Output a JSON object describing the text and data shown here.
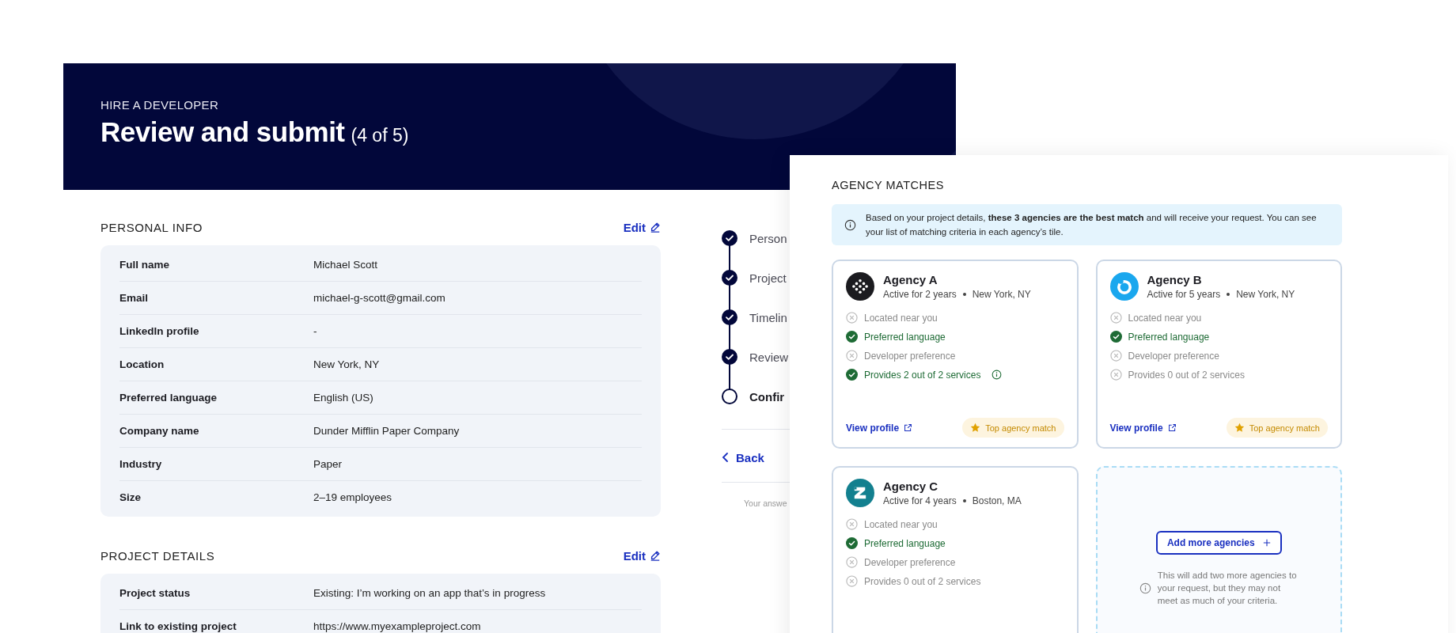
{
  "header": {
    "eyebrow": "HIRE A DEVELOPER",
    "title": "Review and submit",
    "step": "(4 of 5)"
  },
  "sections": [
    {
      "title": "PERSONAL INFO",
      "edit": "Edit",
      "rows": [
        {
          "label": "Full name",
          "value": "Michael Scott"
        },
        {
          "label": "Email",
          "value": "michael-g-scott@gmail.com"
        },
        {
          "label": "LinkedIn profile",
          "value": "-"
        },
        {
          "label": "Location",
          "value": "New York, NY"
        },
        {
          "label": "Preferred language",
          "value": "English (US)"
        },
        {
          "label": "Company name",
          "value": "Dunder Mifflin Paper Company"
        },
        {
          "label": "Industry",
          "value": "Paper"
        },
        {
          "label": "Size",
          "value": "2–19 employees"
        }
      ]
    },
    {
      "title": "PROJECT DETAILS",
      "edit": "Edit",
      "rows": [
        {
          "label": "Project status",
          "value": "Existing: I’m working on an app that’s in progress"
        },
        {
          "label": "Link to existing project",
          "value": "https://www.myexampleproject.com"
        }
      ]
    }
  ],
  "stepper": {
    "steps": [
      {
        "label": "Person",
        "completed": true,
        "current": false
      },
      {
        "label": "Project",
        "completed": true,
        "current": false
      },
      {
        "label": "Timelin",
        "completed": true,
        "current": false
      },
      {
        "label": "Review",
        "completed": true,
        "current": false
      },
      {
        "label": "Confir",
        "completed": false,
        "current": true
      }
    ],
    "back": "Back",
    "footnote": "Your answe"
  },
  "agency_panel": {
    "title": "AGENCY MATCHES",
    "notice": "Based on your project details, **these 3 agencies are the best match** and will receive your request. You can see your list of matching criteria in each agency’s tile.",
    "agencies": [
      {
        "name": "Agency A",
        "active": "Active for 2 years",
        "location": "New York, NY",
        "kind": "dots",
        "color": "#1b1b1f",
        "criteria": [
          {
            "label": "Located near you",
            "met": false,
            "info": false
          },
          {
            "label": "Preferred language",
            "met": true,
            "info": false
          },
          {
            "label": "Developer preference",
            "met": false,
            "info": false
          },
          {
            "label": "Provides 2 out of 2 services",
            "met": true,
            "info": true
          }
        ],
        "link": "View profile",
        "badge": "Top agency match"
      },
      {
        "name": "Agency B",
        "active": "Active for 5 years",
        "location": "New York, NY",
        "kind": "ring",
        "color": "#1aa7ee",
        "criteria": [
          {
            "label": "Located near you",
            "met": false,
            "info": false
          },
          {
            "label": "Preferred language",
            "met": true,
            "info": false
          },
          {
            "label": "Developer preference",
            "met": false,
            "info": false
          },
          {
            "label": "Provides 0 out of 2 services",
            "met": false,
            "info": false
          }
        ],
        "link": "View profile",
        "badge": "Top agency match"
      },
      {
        "name": "Agency C",
        "active": "Active for 4 years",
        "location": "Boston, MA",
        "kind": "zigzag",
        "color": "#13808f",
        "criteria": [
          {
            "label": "Located near you",
            "met": false,
            "info": false
          },
          {
            "label": "Preferred language",
            "met": true,
            "info": false
          },
          {
            "label": "Developer preference",
            "met": false,
            "info": false
          },
          {
            "label": "Provides 0 out of 2 services",
            "met": false,
            "info": false
          }
        ]
      }
    ],
    "add_more": {
      "button": "Add more agencies",
      "note": "This will add two more agencies to your request, but they may not meet as much of your criteria."
    }
  }
}
